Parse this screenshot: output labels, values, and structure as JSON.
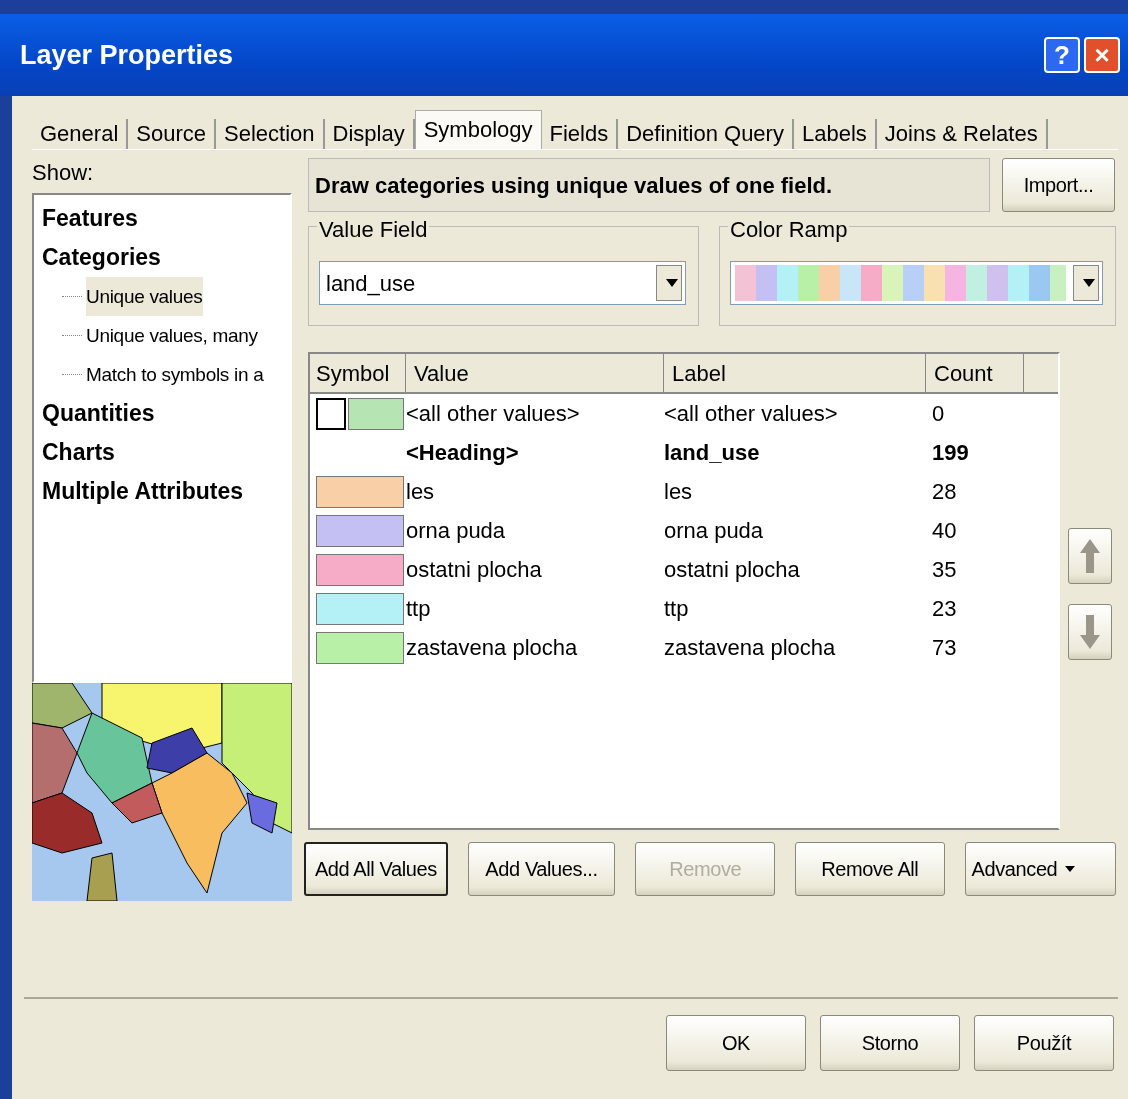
{
  "window": {
    "title": "Layer Properties",
    "help_button": "?",
    "close_button": "×"
  },
  "tabs": [
    {
      "label": "General",
      "selected": false
    },
    {
      "label": "Source",
      "selected": false
    },
    {
      "label": "Selection",
      "selected": false
    },
    {
      "label": "Display",
      "selected": false
    },
    {
      "label": "Symbology",
      "selected": true
    },
    {
      "label": "Fields",
      "selected": false
    },
    {
      "label": "Definition Query",
      "selected": false
    },
    {
      "label": "Labels",
      "selected": false
    },
    {
      "label": "Joins & Relates",
      "selected": false
    }
  ],
  "show": {
    "label": "Show:",
    "tree": [
      {
        "label": "Features",
        "selected": false
      },
      {
        "label": "Categories",
        "selected": false,
        "children": [
          {
            "label": "Unique values",
            "selected": true
          },
          {
            "label": "Unique values, many",
            "selected": false
          },
          {
            "label": "Match to symbols in a",
            "selected": false
          }
        ]
      },
      {
        "label": "Quantities",
        "selected": false
      },
      {
        "label": "Charts",
        "selected": false
      },
      {
        "label": "Multiple Attributes",
        "selected": false
      }
    ]
  },
  "description": "Draw categories using unique values of one field.",
  "import_button": "Import...",
  "value_field": {
    "legend": "Value Field",
    "value": "land_use"
  },
  "color_ramp": {
    "legend": "Color Ramp"
  },
  "table": {
    "columns": [
      "Symbol",
      "Value",
      "Label",
      "Count"
    ],
    "rows": [
      {
        "kind": "default",
        "color": "#b7e4b3",
        "value": "<all other values>",
        "label": "<all other values>",
        "count": "0"
      },
      {
        "kind": "heading",
        "value": "<Heading>",
        "label": "land_use",
        "count": "199"
      },
      {
        "kind": "value",
        "color": "#f9cfa8",
        "value": "les",
        "label": "les",
        "count": "28"
      },
      {
        "kind": "value",
        "color": "#c4c0f3",
        "value": "orna puda",
        "label": "orna puda",
        "count": "40"
      },
      {
        "kind": "value",
        "color": "#f6abc6",
        "value": "ostatni plocha",
        "label": "ostatni plocha",
        "count": "35"
      },
      {
        "kind": "value",
        "color": "#b3f1f6",
        "value": "ttp",
        "label": "ttp",
        "count": "23"
      },
      {
        "kind": "value",
        "color": "#b8f0a8",
        "value": "zastavena plocha",
        "label": "zastavena plocha",
        "count": "73"
      }
    ]
  },
  "actions": [
    {
      "label": "Add All Values",
      "disabled": false,
      "focused": true
    },
    {
      "label": "Add Values...",
      "disabled": false,
      "focused": false
    },
    {
      "label": "Remove",
      "disabled": true,
      "focused": false
    },
    {
      "label": "Remove All",
      "disabled": false,
      "focused": false
    }
  ],
  "advanced_button": "Advanced",
  "dialog_buttons": [
    "OK",
    "Storno",
    "Použít"
  ]
}
